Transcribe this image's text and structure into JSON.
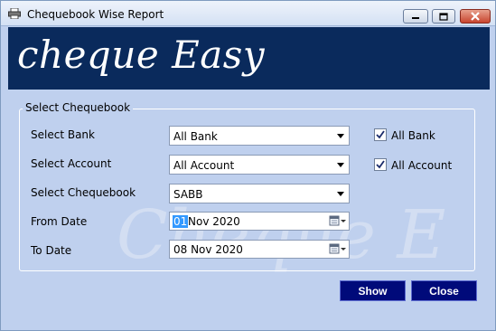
{
  "window": {
    "title": "Chequebook Wise Report"
  },
  "banner": {
    "brand": "cheque Easy",
    "watermark": "Cheque E"
  },
  "group": {
    "legend": "Select Chequebook"
  },
  "fields": {
    "bank": {
      "label": "Select Bank",
      "value": "All Bank"
    },
    "account": {
      "label": "Select Account",
      "value": "All Account"
    },
    "chequebook": {
      "label": "Select Chequebook",
      "value": "SABB"
    },
    "from_date": {
      "label": "From Date",
      "day": "01",
      "rest": "Nov 2020"
    },
    "to_date": {
      "label": "To Date",
      "value": "08 Nov 2020"
    }
  },
  "checks": {
    "all_bank": {
      "label": "All Bank",
      "checked": true
    },
    "all_account": {
      "label": "All Account",
      "checked": true
    }
  },
  "buttons": {
    "show": "Show",
    "close": "Close"
  },
  "colors": {
    "banner": "#0a2a5c",
    "background": "#bfd0ee",
    "button": "#000a7a",
    "selection": "#3399ff"
  }
}
